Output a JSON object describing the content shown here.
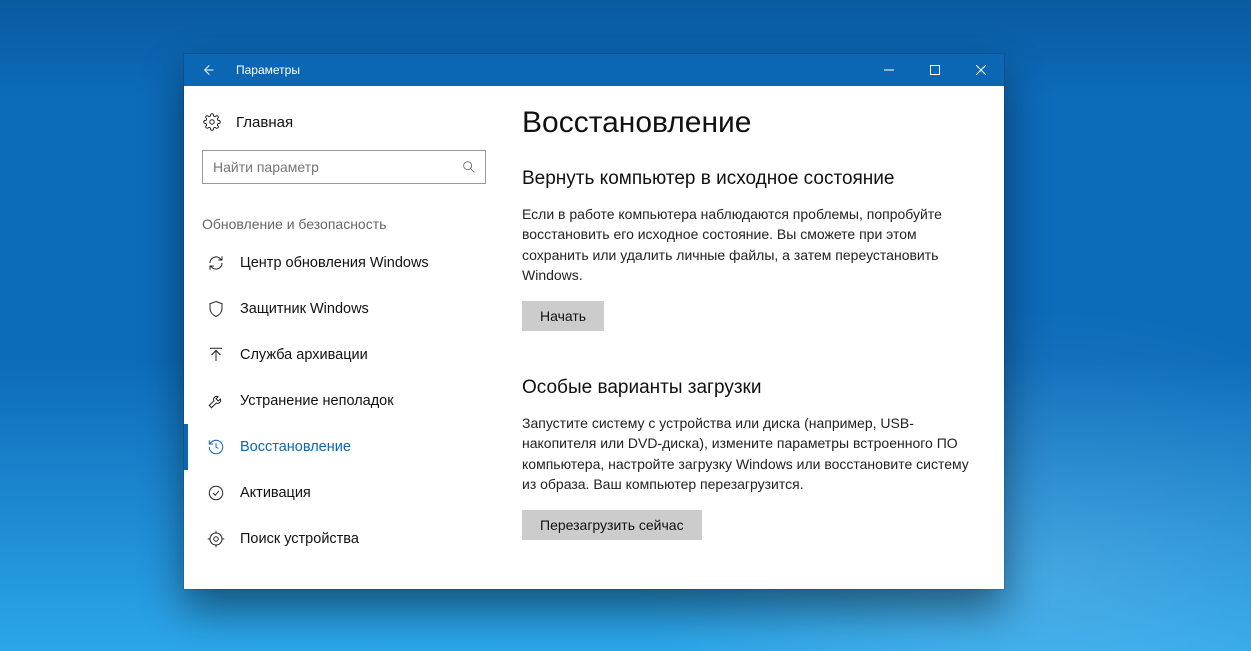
{
  "titlebar": {
    "title": "Параметры"
  },
  "sidebar": {
    "home": "Главная",
    "search_placeholder": "Найти параметр",
    "group": "Обновление и безопасность",
    "items": [
      {
        "label": "Центр обновления Windows",
        "icon": "refresh-icon",
        "active": false
      },
      {
        "label": "Защитник Windows",
        "icon": "shield-icon",
        "active": false
      },
      {
        "label": "Служба архивации",
        "icon": "upload-icon",
        "active": false
      },
      {
        "label": "Устранение неполадок",
        "icon": "wrench-icon",
        "active": false
      },
      {
        "label": "Восстановление",
        "icon": "history-icon",
        "active": true
      },
      {
        "label": "Активация",
        "icon": "check-circle-icon",
        "active": false
      },
      {
        "label": "Поиск устройства",
        "icon": "locate-icon",
        "active": false
      }
    ]
  },
  "content": {
    "page_title": "Восстановление",
    "section1": {
      "heading": "Вернуть компьютер в исходное состояние",
      "body": "Если в работе компьютера наблюдаются проблемы, попробуйте восстановить его исходное состояние. Вы сможете при этом сохранить или удалить личные файлы, а затем переустановить Windows.",
      "button": "Начать"
    },
    "section2": {
      "heading": "Особые варианты загрузки",
      "body": "Запустите систему с устройства или диска (например, USB-накопителя или DVD-диска), измените параметры встроенного ПО компьютера, настройте загрузку Windows или восстановите систему из образа. Ваш компьютер перезагрузится.",
      "button": "Перезагрузить сейчас"
    }
  }
}
